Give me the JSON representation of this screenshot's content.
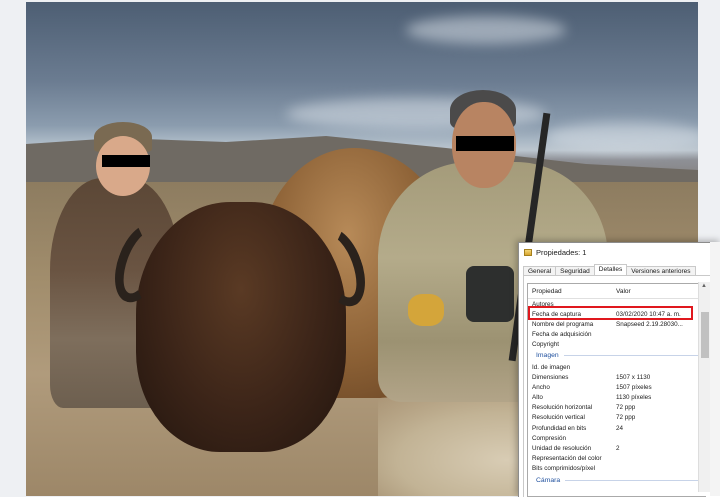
{
  "dialog": {
    "title": "Propiedades: 1",
    "close_glyph": "✕",
    "tabs": [
      "General",
      "Seguridad",
      "Detalles",
      "Versiones anteriores"
    ],
    "active_tab": "Detalles",
    "columns": {
      "property": "Propiedad",
      "value": "Valor"
    },
    "rows_top": [
      {
        "property": "Autores",
        "value": ""
      },
      {
        "property": "Fecha de captura",
        "value": "03/02/2020 10:47 a. m."
      },
      {
        "property": "Nombre del programa",
        "value": "Snapseed 2.19.28030..."
      },
      {
        "property": "Fecha de adquisición",
        "value": ""
      },
      {
        "property": "Copyright",
        "value": ""
      }
    ],
    "section_image": "Imagen",
    "rows_image": [
      {
        "property": "Id. de imagen",
        "value": ""
      },
      {
        "property": "Dimensiones",
        "value": "1507 x 1130"
      },
      {
        "property": "Ancho",
        "value": "1507 píxeles"
      },
      {
        "property": "Alto",
        "value": "1130 píxeles"
      },
      {
        "property": "Resolución horizontal",
        "value": "72 ppp"
      },
      {
        "property": "Resolución vertical",
        "value": "72 ppp"
      },
      {
        "property": "Profundidad en bits",
        "value": "24"
      },
      {
        "property": "Compresión",
        "value": ""
      },
      {
        "property": "Unidad de resolución",
        "value": "2"
      },
      {
        "property": "Representación del color",
        "value": ""
      },
      {
        "property": "Bits comprimidos/píxel",
        "value": ""
      }
    ],
    "section_camera": "Cámara",
    "highlight_color": "#e0181e"
  }
}
